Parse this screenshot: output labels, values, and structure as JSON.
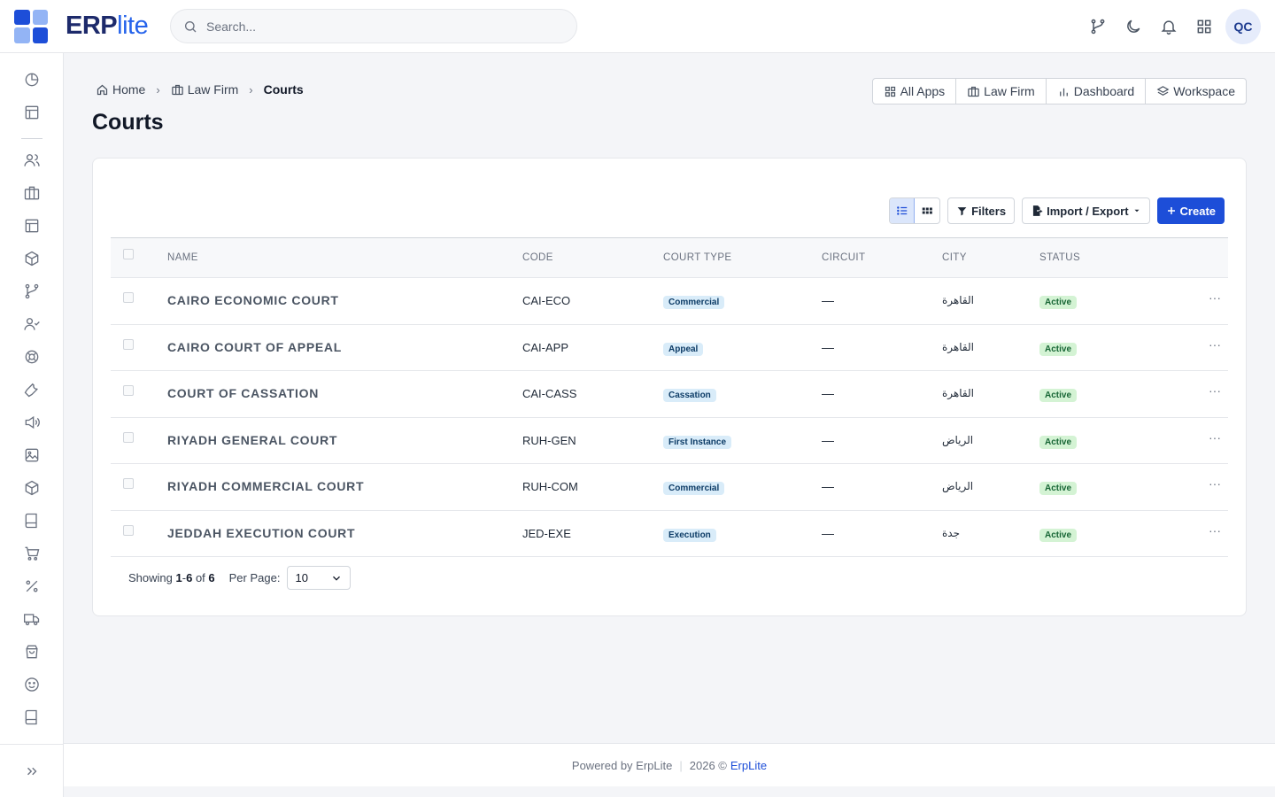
{
  "app": {
    "brand_bold": "ERP",
    "brand_light": "lite",
    "logo_colors": [
      "#1d4ed8",
      "#93b4f5",
      "#93b4f5",
      "#1d4ed8"
    ]
  },
  "search": {
    "placeholder": "Search..."
  },
  "topbar": {
    "icons": [
      "git-branch-icon",
      "moon-icon",
      "bell-icon",
      "apps-grid-icon"
    ],
    "avatar_initials": "QC"
  },
  "sidebar": {
    "icons": [
      "pie-chart-icon",
      "layout-icon",
      "users-icon",
      "briefcase-icon",
      "layout-icon",
      "package-icon",
      "git-branch-icon",
      "user-check-icon",
      "lifebuoy-icon",
      "wrench-icon",
      "megaphone-icon",
      "image-icon",
      "box-icon",
      "book-icon",
      "cart-icon",
      "percent-icon",
      "truck-icon",
      "shopping-bag-icon",
      "smile-icon",
      "book-icon",
      "open-book-icon"
    ],
    "expand_icon": "chevrons-right-icon"
  },
  "breadcrumb": {
    "home": "Home",
    "parent": "Law Firm",
    "current": "Courts"
  },
  "page": {
    "title": "Courts"
  },
  "quick_links": [
    "All Apps",
    "Law Firm",
    "Dashboard",
    "Workspace"
  ],
  "toolbar": {
    "filters_label": "Filters",
    "import_export_label": "Import / Export",
    "create_label": "Create"
  },
  "table": {
    "columns": [
      "NAME",
      "CODE",
      "COURT TYPE",
      "CIRCUIT",
      "CITY",
      "STATUS"
    ],
    "rows": [
      {
        "name": "CAIRO ECONOMIC COURT",
        "code": "CAI-ECO",
        "type": "Commercial",
        "circuit": "—",
        "city": "القاهرة",
        "status": "Active"
      },
      {
        "name": "CAIRO COURT OF APPEAL",
        "code": "CAI-APP",
        "type": "Appeal",
        "circuit": "—",
        "city": "القاهرة",
        "status": "Active"
      },
      {
        "name": "COURT OF CASSATION",
        "code": "CAI-CASS",
        "type": "Cassation",
        "circuit": "—",
        "city": "القاهرة",
        "status": "Active"
      },
      {
        "name": "RIYADH GENERAL COURT",
        "code": "RUH-GEN",
        "type": "First Instance",
        "circuit": "—",
        "city": "الرياض",
        "status": "Active"
      },
      {
        "name": "RIYADH COMMERCIAL COURT",
        "code": "RUH-COM",
        "type": "Commercial",
        "circuit": "—",
        "city": "الرياض",
        "status": "Active"
      },
      {
        "name": "JEDDAH EXECUTION COURT",
        "code": "JED-EXE",
        "type": "Execution",
        "circuit": "—",
        "city": "جدة",
        "status": "Active"
      }
    ],
    "row_action": "···"
  },
  "pager": {
    "showing_label": "Showing",
    "range_start": "1",
    "range_end": "6",
    "of_label": "of",
    "total": "6",
    "per_page_label": "Per Page:",
    "per_page_value": "10"
  },
  "footer": {
    "powered_by": "Powered by ErpLite",
    "year": "2026 ©",
    "link": "ErpLite"
  }
}
